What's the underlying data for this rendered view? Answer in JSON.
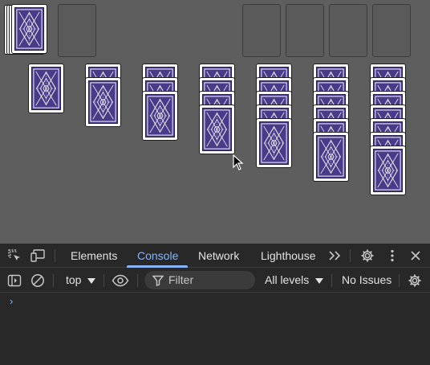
{
  "game": {
    "stock_icon": "card-back-icon",
    "card_back_color": "#4a3a8a",
    "foundation_slots": 4,
    "tableau": [
      {
        "face_down": 0,
        "face_up_back": 1
      },
      {
        "face_down": 1,
        "face_up_back": 1
      },
      {
        "face_down": 2,
        "face_up_back": 1
      },
      {
        "face_down": 3,
        "face_up_back": 1
      },
      {
        "face_down": 4,
        "face_up_back": 1
      },
      {
        "face_down": 5,
        "face_up_back": 1
      },
      {
        "face_down": 6,
        "face_up_back": 1
      }
    ]
  },
  "devtools": {
    "tabs": [
      "Elements",
      "Console",
      "Network",
      "Lighthouse"
    ],
    "active_tab": "Console",
    "more_tabs_glyph": ">>",
    "context": "top",
    "filter_placeholder": "Filter",
    "levels": "All levels",
    "issues": "No Issues",
    "prompt": "›",
    "accent": "#8ab4f8"
  }
}
